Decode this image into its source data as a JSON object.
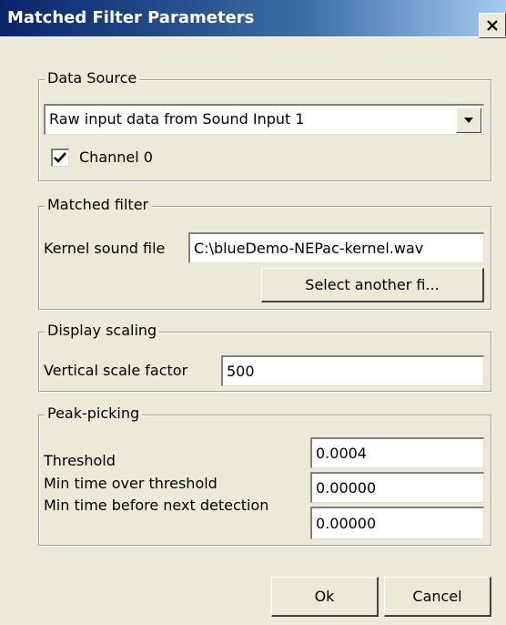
{
  "window": {
    "title": "Matched Filter Parameters",
    "close_icon": "close-icon"
  },
  "data_source": {
    "legend": "Data Source",
    "selected_source": "Raw input data from Sound Input 1",
    "channel_label": "Channel 0",
    "channel_checked": true
  },
  "matched_filter": {
    "legend": "Matched filter",
    "kernel_label": "Kernel sound file",
    "kernel_value": "C:\\blueDemo-NEPac-kernel.wav",
    "select_button": "Select another fi..."
  },
  "display_scaling": {
    "legend": "Display scaling",
    "vertical_label": "Vertical scale factor",
    "vertical_value": "500"
  },
  "peak_picking": {
    "legend": "Peak-picking",
    "threshold_label": "Threshold",
    "threshold_value": "0.0004",
    "min_over_label": "Min time over threshold",
    "min_over_value": "0.00000",
    "min_before_label": "Min time before next detection",
    "min_before_value": "0.00000"
  },
  "buttons": {
    "ok": "Ok",
    "cancel": "Cancel"
  }
}
